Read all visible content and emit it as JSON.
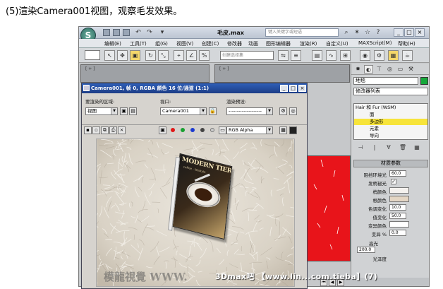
{
  "caption": "(5)渲染Camera001视图，观察毛发效果。",
  "app": {
    "logo_glyph": "S",
    "title": "毛皮.max",
    "search_placeholder": "键入关键字或短语",
    "menu": [
      "编辑(E)",
      "工具(T)",
      "组(G)",
      "视图(V)",
      "创建(C)",
      "修改器",
      "动画",
      "图形编辑器",
      "渲染(R)",
      "自定义(U)",
      "MAXScript(M)",
      "帮助(H)"
    ],
    "selection_set_placeholder": "创建选择集",
    "viewport_labels": [
      "[ + ]",
      "[ + ]"
    ]
  },
  "command_panel": {
    "object_name": "地毯",
    "object_color": "#16a83a",
    "modifier_list": "修改器列表",
    "stack": [
      "Hair 和 Fur (WSM)",
      "面",
      "多边形",
      "元素",
      "导向"
    ],
    "selected_stack_index": 2,
    "rollout_title": "材质参数",
    "params": [
      {
        "label": "阻挡环境光",
        "value": "60.0"
      },
      {
        "label": "发梢褪光",
        "value": "✓"
      },
      {
        "label": "梢颜色",
        "value": ""
      },
      {
        "label": "根颜色",
        "value": ""
      },
      {
        "label": "色调变化",
        "value": "10.0"
      },
      {
        "label": "值变化",
        "value": "50.0"
      },
      {
        "label": "变异颜色",
        "value": ""
      },
      {
        "label": "变异 %",
        "value": "0.0"
      }
    ],
    "highlight_label": "高光",
    "highlight_value": "200.0",
    "gloss_label": "光泽度"
  },
  "render_window": {
    "title": "Camera001, 帧 0, RGBA 颜色 16 位/通道 (1:1)",
    "area_label": "要渲染的区域:",
    "area_value": "视图",
    "viewport_label": "视口:",
    "viewport_value": "Camera001",
    "preset_label": "渲染预设:",
    "preset_value": "--------------------",
    "channel_value": "RGB Alpha",
    "book_title": "MODERN TIER",
    "book_subtitle": "coffee · lifestyle",
    "watermark_left": "模龍視覺 WWW."
  },
  "footer_watermark": "3Dmax吧 【www.lin...com.tieba】(7)"
}
